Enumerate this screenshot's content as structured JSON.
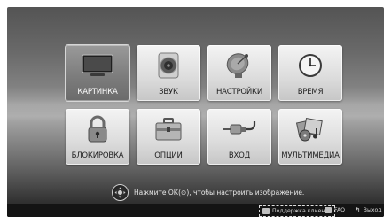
{
  "menu": {
    "items": [
      {
        "label": "КАРТИНКА",
        "icon": "tv-icon",
        "selected": true
      },
      {
        "label": "ЗВУК",
        "icon": "speaker-icon",
        "selected": false
      },
      {
        "label": "НАСТРОЙКИ",
        "icon": "satellite-dish-icon",
        "selected": false
      },
      {
        "label": "ВРЕМЯ",
        "icon": "clock-icon",
        "selected": false
      },
      {
        "label": "БЛОКИРОВКА",
        "icon": "padlock-icon",
        "selected": false
      },
      {
        "label": "ОПЦИИ",
        "icon": "toolbox-icon",
        "selected": false
      },
      {
        "label": "ВХОД",
        "icon": "input-cable-icon",
        "selected": false
      },
      {
        "label": "МУЛЬТИМЕДИА",
        "icon": "multimedia-icon",
        "selected": false
      }
    ]
  },
  "hint": {
    "icon": "navigation-knob-icon",
    "text": "Нажмите ОК(⊙), чтобы настроить изображение."
  },
  "bottom_bar": {
    "support": "Поддержка клиента",
    "faq": "FAQ",
    "exit": "Выход"
  },
  "colors": {
    "tile": "#e2e2e2",
    "tile_selected": "#7d7d7d",
    "bar": "#141414"
  }
}
